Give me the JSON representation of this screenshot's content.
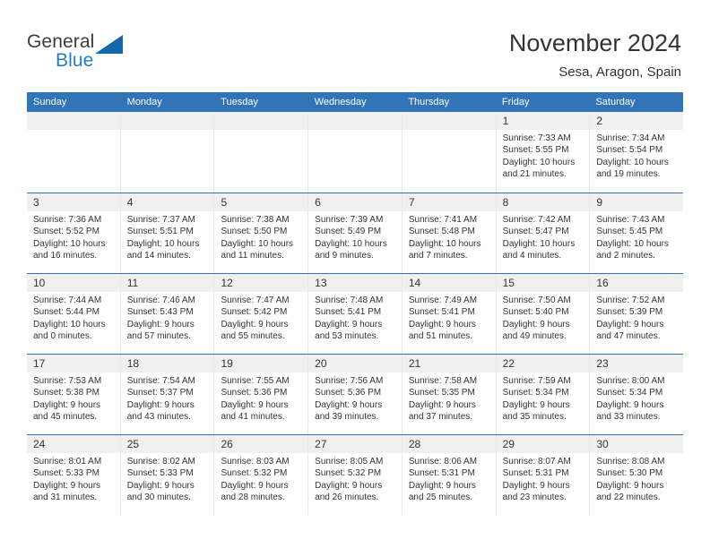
{
  "brand": {
    "name_part1": "General",
    "name_part2": "Blue",
    "triangle_color": "#1267ae",
    "blue_text_color": "#1f7ec4"
  },
  "header": {
    "title": "November 2024",
    "subtitle": "Sesa, Aragon, Spain"
  },
  "theme": {
    "header_blue": "#3174b8",
    "day_strip_gray": "#f0f0f0",
    "text_color": "#333333"
  },
  "weekdays": [
    "Sunday",
    "Monday",
    "Tuesday",
    "Wednesday",
    "Thursday",
    "Friday",
    "Saturday"
  ],
  "weeks": [
    [
      {
        "day": "",
        "empty": true
      },
      {
        "day": "",
        "empty": true
      },
      {
        "day": "",
        "empty": true
      },
      {
        "day": "",
        "empty": true
      },
      {
        "day": "",
        "empty": true
      },
      {
        "day": "1",
        "sunrise": "Sunrise: 7:33 AM",
        "sunset": "Sunset: 5:55 PM",
        "daylight": "Daylight: 10 hours and 21 minutes."
      },
      {
        "day": "2",
        "sunrise": "Sunrise: 7:34 AM",
        "sunset": "Sunset: 5:54 PM",
        "daylight": "Daylight: 10 hours and 19 minutes."
      }
    ],
    [
      {
        "day": "3",
        "sunrise": "Sunrise: 7:36 AM",
        "sunset": "Sunset: 5:52 PM",
        "daylight": "Daylight: 10 hours and 16 minutes."
      },
      {
        "day": "4",
        "sunrise": "Sunrise: 7:37 AM",
        "sunset": "Sunset: 5:51 PM",
        "daylight": "Daylight: 10 hours and 14 minutes."
      },
      {
        "day": "5",
        "sunrise": "Sunrise: 7:38 AM",
        "sunset": "Sunset: 5:50 PM",
        "daylight": "Daylight: 10 hours and 11 minutes."
      },
      {
        "day": "6",
        "sunrise": "Sunrise: 7:39 AM",
        "sunset": "Sunset: 5:49 PM",
        "daylight": "Daylight: 10 hours and 9 minutes."
      },
      {
        "day": "7",
        "sunrise": "Sunrise: 7:41 AM",
        "sunset": "Sunset: 5:48 PM",
        "daylight": "Daylight: 10 hours and 7 minutes."
      },
      {
        "day": "8",
        "sunrise": "Sunrise: 7:42 AM",
        "sunset": "Sunset: 5:47 PM",
        "daylight": "Daylight: 10 hours and 4 minutes."
      },
      {
        "day": "9",
        "sunrise": "Sunrise: 7:43 AM",
        "sunset": "Sunset: 5:45 PM",
        "daylight": "Daylight: 10 hours and 2 minutes."
      }
    ],
    [
      {
        "day": "10",
        "sunrise": "Sunrise: 7:44 AM",
        "sunset": "Sunset: 5:44 PM",
        "daylight": "Daylight: 10 hours and 0 minutes."
      },
      {
        "day": "11",
        "sunrise": "Sunrise: 7:46 AM",
        "sunset": "Sunset: 5:43 PM",
        "daylight": "Daylight: 9 hours and 57 minutes."
      },
      {
        "day": "12",
        "sunrise": "Sunrise: 7:47 AM",
        "sunset": "Sunset: 5:42 PM",
        "daylight": "Daylight: 9 hours and 55 minutes."
      },
      {
        "day": "13",
        "sunrise": "Sunrise: 7:48 AM",
        "sunset": "Sunset: 5:41 PM",
        "daylight": "Daylight: 9 hours and 53 minutes."
      },
      {
        "day": "14",
        "sunrise": "Sunrise: 7:49 AM",
        "sunset": "Sunset: 5:41 PM",
        "daylight": "Daylight: 9 hours and 51 minutes."
      },
      {
        "day": "15",
        "sunrise": "Sunrise: 7:50 AM",
        "sunset": "Sunset: 5:40 PM",
        "daylight": "Daylight: 9 hours and 49 minutes."
      },
      {
        "day": "16",
        "sunrise": "Sunrise: 7:52 AM",
        "sunset": "Sunset: 5:39 PM",
        "daylight": "Daylight: 9 hours and 47 minutes."
      }
    ],
    [
      {
        "day": "17",
        "sunrise": "Sunrise: 7:53 AM",
        "sunset": "Sunset: 5:38 PM",
        "daylight": "Daylight: 9 hours and 45 minutes."
      },
      {
        "day": "18",
        "sunrise": "Sunrise: 7:54 AM",
        "sunset": "Sunset: 5:37 PM",
        "daylight": "Daylight: 9 hours and 43 minutes."
      },
      {
        "day": "19",
        "sunrise": "Sunrise: 7:55 AM",
        "sunset": "Sunset: 5:36 PM",
        "daylight": "Daylight: 9 hours and 41 minutes."
      },
      {
        "day": "20",
        "sunrise": "Sunrise: 7:56 AM",
        "sunset": "Sunset: 5:36 PM",
        "daylight": "Daylight: 9 hours and 39 minutes."
      },
      {
        "day": "21",
        "sunrise": "Sunrise: 7:58 AM",
        "sunset": "Sunset: 5:35 PM",
        "daylight": "Daylight: 9 hours and 37 minutes."
      },
      {
        "day": "22",
        "sunrise": "Sunrise: 7:59 AM",
        "sunset": "Sunset: 5:34 PM",
        "daylight": "Daylight: 9 hours and 35 minutes."
      },
      {
        "day": "23",
        "sunrise": "Sunrise: 8:00 AM",
        "sunset": "Sunset: 5:34 PM",
        "daylight": "Daylight: 9 hours and 33 minutes."
      }
    ],
    [
      {
        "day": "24",
        "sunrise": "Sunrise: 8:01 AM",
        "sunset": "Sunset: 5:33 PM",
        "daylight": "Daylight: 9 hours and 31 minutes."
      },
      {
        "day": "25",
        "sunrise": "Sunrise: 8:02 AM",
        "sunset": "Sunset: 5:33 PM",
        "daylight": "Daylight: 9 hours and 30 minutes."
      },
      {
        "day": "26",
        "sunrise": "Sunrise: 8:03 AM",
        "sunset": "Sunset: 5:32 PM",
        "daylight": "Daylight: 9 hours and 28 minutes."
      },
      {
        "day": "27",
        "sunrise": "Sunrise: 8:05 AM",
        "sunset": "Sunset: 5:32 PM",
        "daylight": "Daylight: 9 hours and 26 minutes."
      },
      {
        "day": "28",
        "sunrise": "Sunrise: 8:06 AM",
        "sunset": "Sunset: 5:31 PM",
        "daylight": "Daylight: 9 hours and 25 minutes."
      },
      {
        "day": "29",
        "sunrise": "Sunrise: 8:07 AM",
        "sunset": "Sunset: 5:31 PM",
        "daylight": "Daylight: 9 hours and 23 minutes."
      },
      {
        "day": "30",
        "sunrise": "Sunrise: 8:08 AM",
        "sunset": "Sunset: 5:30 PM",
        "daylight": "Daylight: 9 hours and 22 minutes."
      }
    ]
  ]
}
